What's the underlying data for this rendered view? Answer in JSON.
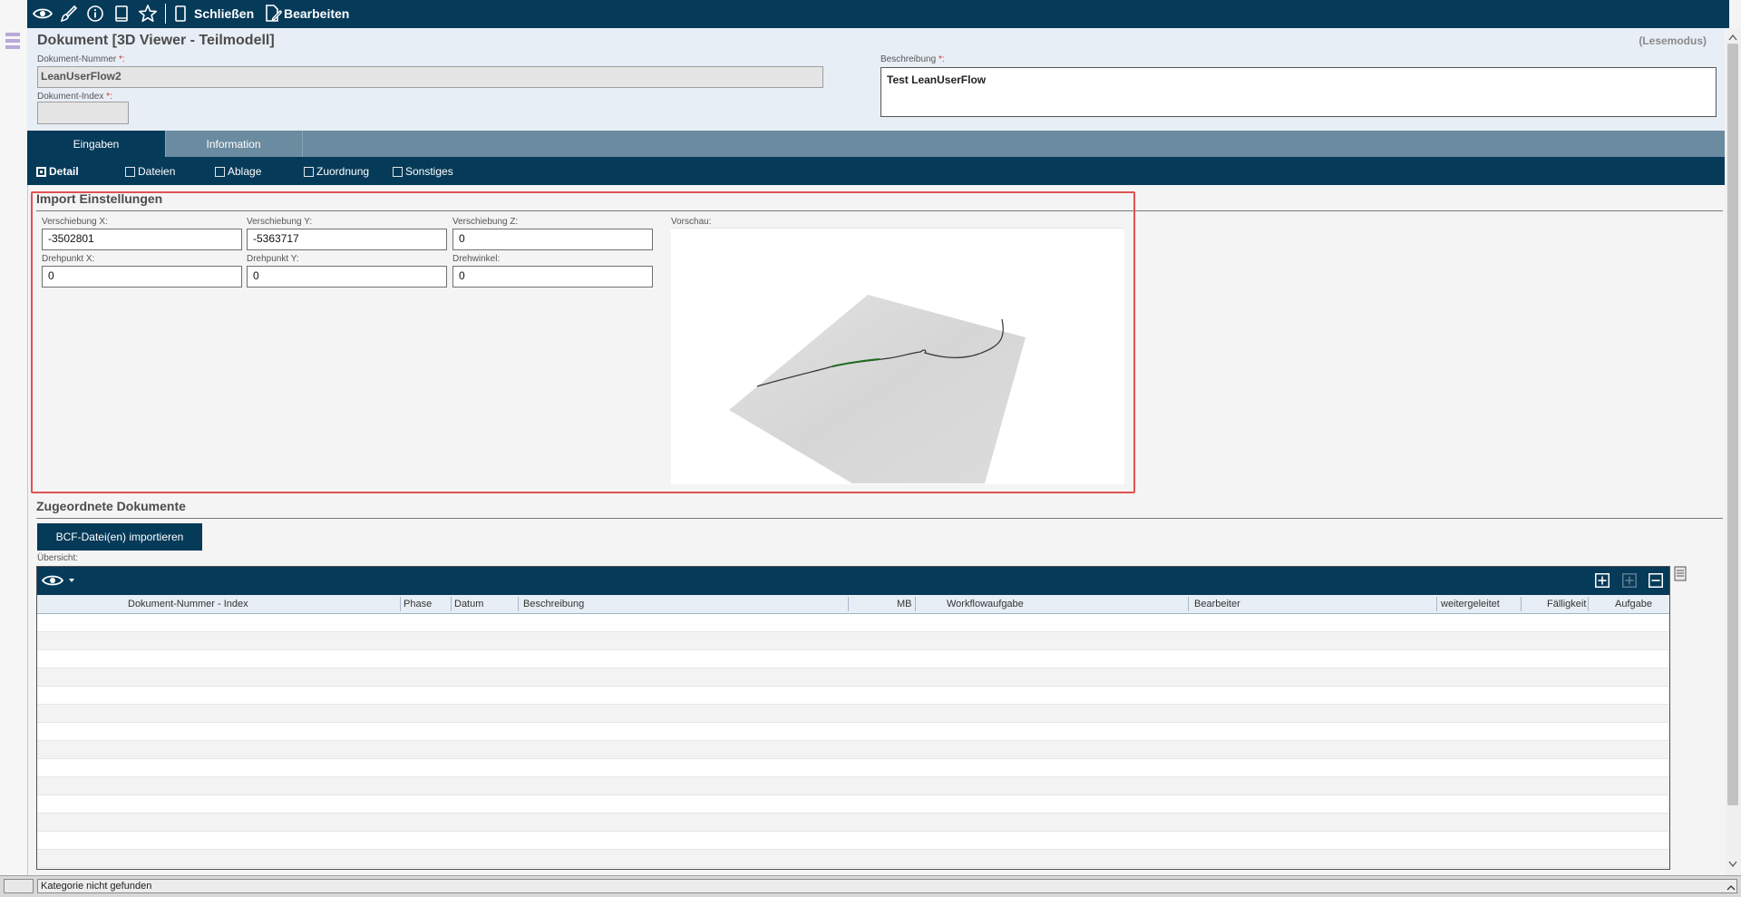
{
  "toolbar": {
    "icons": [
      "eye-icon",
      "brush-icon",
      "info-icon",
      "tablet-icon",
      "star-icon"
    ],
    "close_label": "Schließen",
    "edit_label": "Bearbeiten"
  },
  "header": {
    "title": "Dokument [3D Viewer - Teilmodell]",
    "mode": "(Lesemodus)",
    "doc_number_label": "Dokument-Nummer ",
    "doc_number_value": "LeanUserFlow2",
    "doc_index_label": "Dokument-Index ",
    "doc_index_value": "",
    "description_label": "Beschreibung ",
    "description_value": "Test LeanUserFlow",
    "required_mark": "*:"
  },
  "tabs": [
    {
      "label": "Eingaben",
      "active": true
    },
    {
      "label": "Information",
      "active": false
    }
  ],
  "subtabs": [
    {
      "label": "Detail",
      "active": true
    },
    {
      "label": "Dateien",
      "active": false
    },
    {
      "label": "Ablage",
      "active": false
    },
    {
      "label": "Zuordnung",
      "active": false
    },
    {
      "label": "Sonstiges",
      "active": false
    }
  ],
  "import_settings": {
    "title": "Import Einstellungen",
    "fields": [
      {
        "label": "Verschiebung X:",
        "value": "-3502801"
      },
      {
        "label": "Verschiebung Y:",
        "value": "-5363717"
      },
      {
        "label": "Verschiebung Z:",
        "value": "0"
      },
      {
        "label": "Drehpunkt X:",
        "value": "0"
      },
      {
        "label": "Drehpunkt Y:",
        "value": "0"
      },
      {
        "label": "Drehwinkel:",
        "value": "0"
      }
    ],
    "preview_label": "Vorschau:"
  },
  "assigned_documents": {
    "title": "Zugeordnete Dokumente",
    "import_button": "BCF-Datei(en) importieren",
    "overview_label": "Übersicht:",
    "columns": [
      "Dokument-Nummer - Index",
      "Phase",
      "Datum",
      "Beschreibung",
      "MB",
      "Workflowaufgabe",
      "Bearbeiter",
      "weitergeleitet",
      "Fälligkeit",
      "Aufgabe"
    ],
    "rows": []
  },
  "status": {
    "text": "Kategorie nicht gefunden"
  },
  "colors": {
    "primary": "#053a59",
    "tab_bar": "#6a8ba0",
    "header_bg": "#e8eef6",
    "highlight_frame": "#e05252"
  }
}
